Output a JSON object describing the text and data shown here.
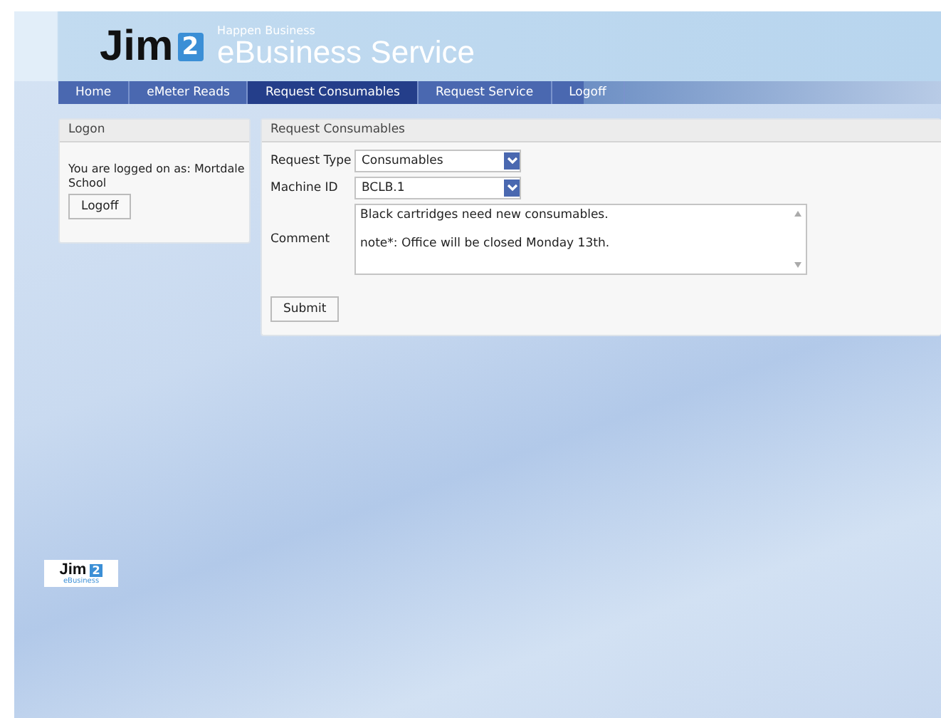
{
  "header": {
    "logo": "Jim",
    "logo_badge": "2",
    "tagline": "Happen Business",
    "title": "eBusiness Service"
  },
  "nav": [
    {
      "label": "Home",
      "selected": false
    },
    {
      "label": "eMeter Reads",
      "selected": false
    },
    {
      "label": "Request Consumables",
      "selected": true
    },
    {
      "label": "Request Service",
      "selected": false
    },
    {
      "label": "Logoff",
      "selected": false
    }
  ],
  "logon_panel": {
    "title": "Logon",
    "message": "You are logged on as: Mortdale School",
    "button": "Logoff"
  },
  "request_panel": {
    "title": "Request Consumables",
    "fields": [
      {
        "label": "Request Type",
        "kind": "select",
        "value": "Consumables"
      },
      {
        "label": "Machine ID",
        "kind": "select",
        "value": "BCLB.1"
      },
      {
        "label": "Comment",
        "kind": "textarea",
        "value": "Black cartridges need new consumables.\n\nnote*: Office will be closed Monday 13th."
      }
    ],
    "button": "Submit"
  },
  "footer_logo": {
    "logo": "Jim",
    "logo_badge": "2",
    "caption": "eBusiness"
  }
}
